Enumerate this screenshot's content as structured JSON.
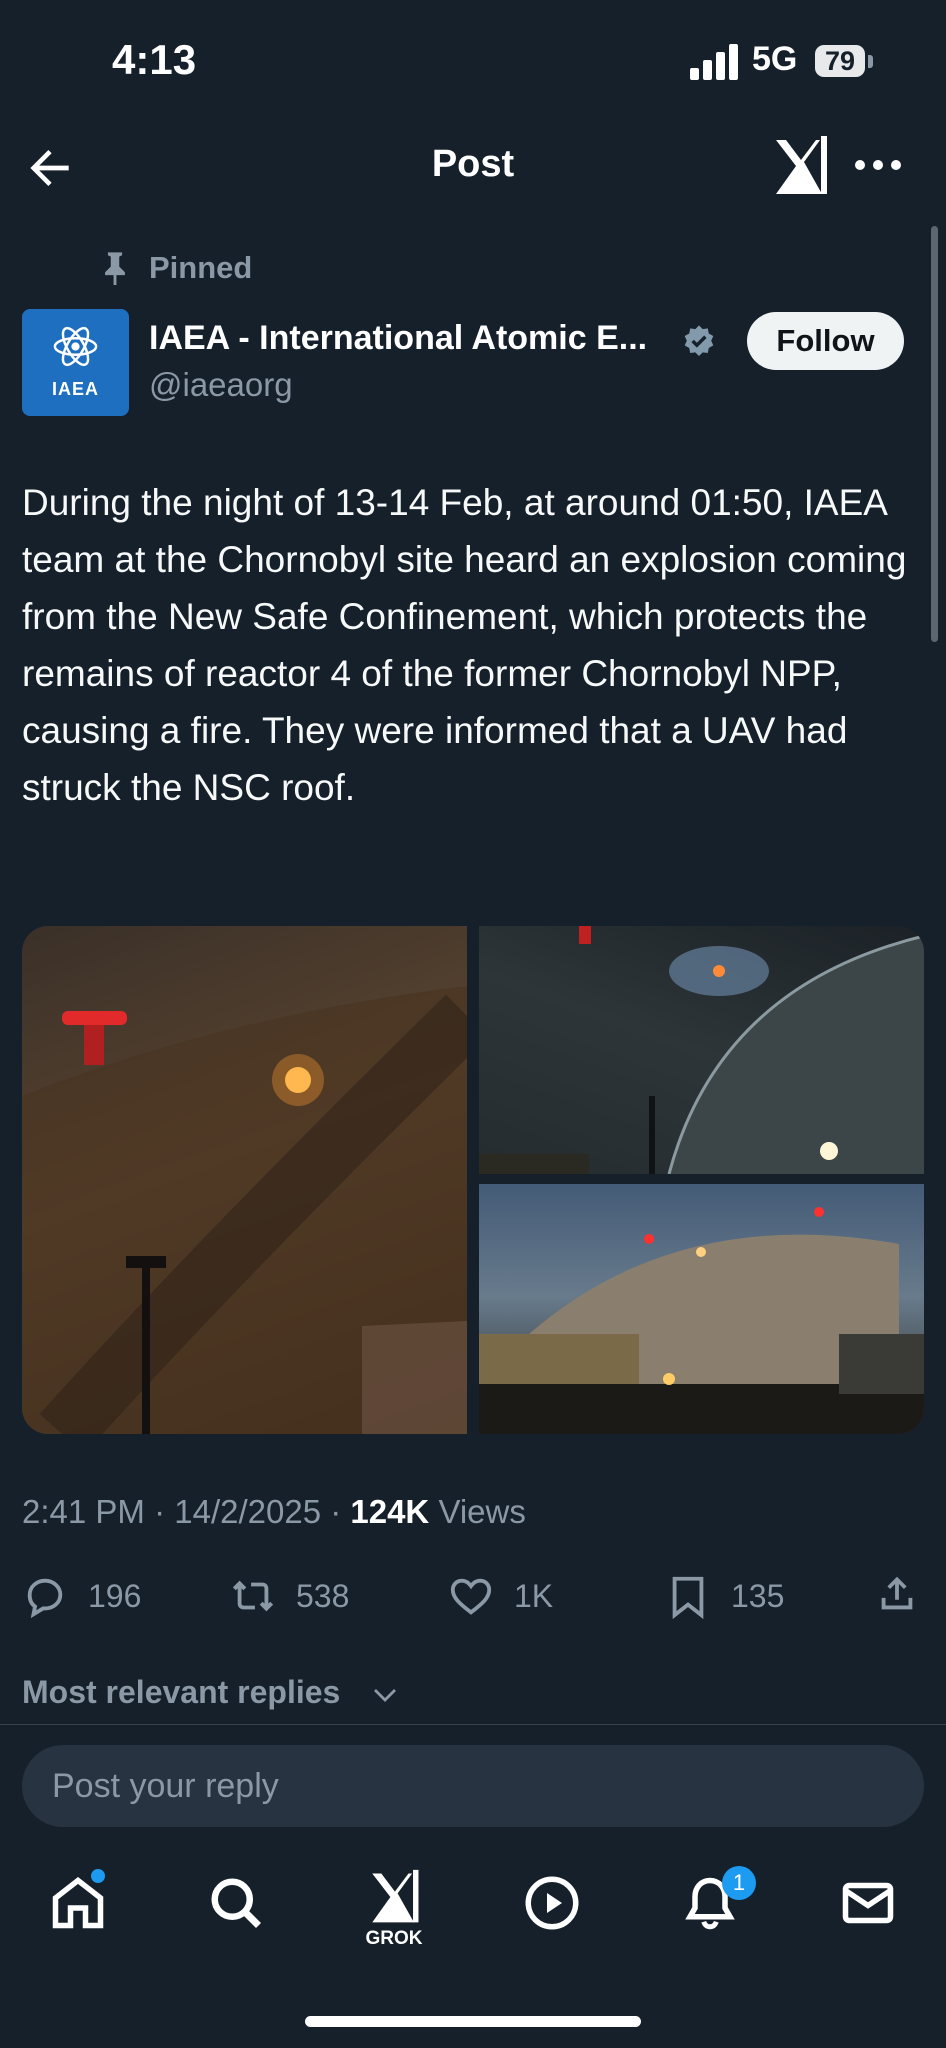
{
  "status_bar": {
    "time": "4:13",
    "network": "5G",
    "battery": "79"
  },
  "header": {
    "title": "Post"
  },
  "post": {
    "pinned_label": "Pinned",
    "avatar_text": "IAEA",
    "display_name": "IAEA - International Atomic E...",
    "handle": "@iaeaorg",
    "follow_label": "Follow",
    "body": "During the night of 13-14 Feb, at around 01:50, IAEA team at the Chornobyl site heard an explosion coming from the New Safe Confinement, which protects the remains of reactor 4 of the former Chornobyl NPP, causing a fire. They were informed that a UAV had struck the NSC roof.",
    "time": "2:41 PM",
    "date": "14/2/2025",
    "views_count": "124K",
    "views_label": "Views",
    "replies": "196",
    "reposts": "538",
    "likes": "1K",
    "bookmarks": "135"
  },
  "replies_section": {
    "sort_label": "Most relevant replies",
    "reply_placeholder": "Post your reply"
  },
  "tab_bar": {
    "grok_label": "GROK",
    "notification_count": "1"
  },
  "colors": {
    "background": "#15202b",
    "accent": "#1d9bf0",
    "avatar": "#1e6fc0",
    "muted_text": "#8b98a5"
  },
  "icons": [
    "back-arrow-icon",
    "grok-icon",
    "more-icon",
    "pin-icon",
    "verified-badge-icon",
    "reply-icon",
    "repost-icon",
    "like-icon",
    "bookmark-icon",
    "share-icon",
    "chevron-down-icon",
    "home-icon",
    "search-icon",
    "video-icon",
    "bell-icon",
    "mail-icon"
  ]
}
